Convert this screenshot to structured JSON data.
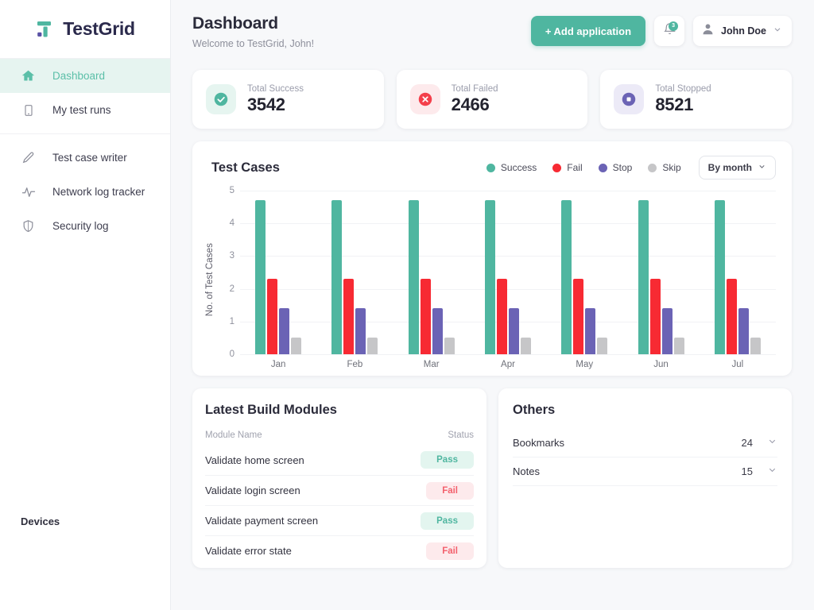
{
  "brand": {
    "name": "TestGrid",
    "logo_icon": "testgrid-logo-icon",
    "accent": "#4fb6a0",
    "dark": "#2b2a4c"
  },
  "sidebar": {
    "primary_items": [
      {
        "label": "Dashboard",
        "icon": "home-icon",
        "active": true
      },
      {
        "label": "My test runs",
        "icon": "tablet-icon",
        "active": false
      }
    ],
    "secondary_items": [
      {
        "label": "Test case writer",
        "icon": "pen-icon",
        "active": false
      },
      {
        "label": "Network log tracker",
        "icon": "activity-pulse-icon",
        "active": false
      },
      {
        "label": "Security log",
        "icon": "shield-icon",
        "active": false
      }
    ],
    "footer_label": "Devices"
  },
  "header": {
    "title": "Dashboard",
    "subtitle": "Welcome to TestGrid, John!",
    "add_button": "+ Add application",
    "bell_icon": "bell-icon",
    "notification_count": "3",
    "avatar_icon": "avatar-icon",
    "user_name": "John Doe",
    "chevron_icon": "chevron-down-icon"
  },
  "stats": [
    {
      "label": "Total Success",
      "value": "3542",
      "icon": "check-circle-icon",
      "color": "#4fb6a0",
      "bg": "#e6f5f0"
    },
    {
      "label": "Total Failed",
      "value": "2466",
      "icon": "x-circle-icon",
      "color": "#f43f4b",
      "bg": "#fdeaec"
    },
    {
      "label": "Total Stopped",
      "value": "8521",
      "icon": "stop-circle-icon",
      "color": "#6b63b5",
      "bg": "#eceaf7"
    }
  ],
  "chart_card": {
    "title": "Test Cases",
    "range_selector": {
      "value": "By month",
      "icon": "chevron-down-icon"
    }
  },
  "chart_data": {
    "type": "bar",
    "title": "Test Cases",
    "xlabel": "",
    "ylabel": "No. of Test Cases",
    "ylim": [
      0,
      5
    ],
    "yticks": [
      0,
      1,
      2,
      3,
      4,
      5
    ],
    "grid": true,
    "legend_position": "top-right",
    "categories": [
      "Jan",
      "Feb",
      "Mar",
      "Apr",
      "May",
      "Jun",
      "Jul"
    ],
    "series": [
      {
        "name": "Success",
        "color": "#4fb6a0",
        "values": [
          4.7,
          4.7,
          4.7,
          4.7,
          4.7,
          4.7,
          4.7
        ]
      },
      {
        "name": "Fail",
        "color": "#f72a33",
        "values": [
          2.3,
          2.3,
          2.3,
          2.3,
          2.3,
          2.3,
          2.3
        ]
      },
      {
        "name": "Stop",
        "color": "#6b63b5",
        "values": [
          1.4,
          1.4,
          1.4,
          1.4,
          1.4,
          1.4,
          1.4
        ]
      },
      {
        "name": "Skip",
        "color": "#c6c6c8",
        "values": [
          0.5,
          0.5,
          0.5,
          0.5,
          0.5,
          0.5,
          0.5
        ]
      }
    ]
  },
  "modules_panel": {
    "title": "Latest Build Modules",
    "col_name": "Module Name",
    "col_status": "Status",
    "rows": [
      {
        "name": "Validate home screen",
        "status": "Pass"
      },
      {
        "name": "Validate login screen",
        "status": "Fail"
      },
      {
        "name": "Validate payment screen",
        "status": "Pass"
      },
      {
        "name": "Validate error state",
        "status": "Fail"
      }
    ]
  },
  "others_panel": {
    "title": "Others",
    "rows": [
      {
        "name": "Bookmarks",
        "count": "24",
        "icon": "chevron-down-icon"
      },
      {
        "name": "Notes",
        "count": "15",
        "icon": "chevron-down-icon"
      }
    ]
  }
}
